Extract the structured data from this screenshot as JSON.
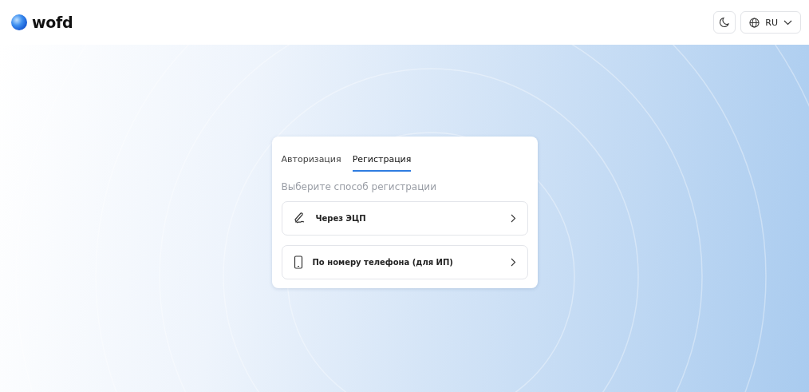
{
  "header": {
    "logo": "wofd",
    "language": "RU"
  },
  "tabs": [
    {
      "label": "Авторизация",
      "selected": false
    },
    {
      "label": "Регистрация",
      "selected": true
    }
  ],
  "prompt": "Выберите способ регистрации",
  "options": [
    {
      "kind": "signature",
      "label": "Через ЭЦП"
    },
    {
      "kind": "phone",
      "label": "По номеру телефона (для ИП)"
    }
  ]
}
